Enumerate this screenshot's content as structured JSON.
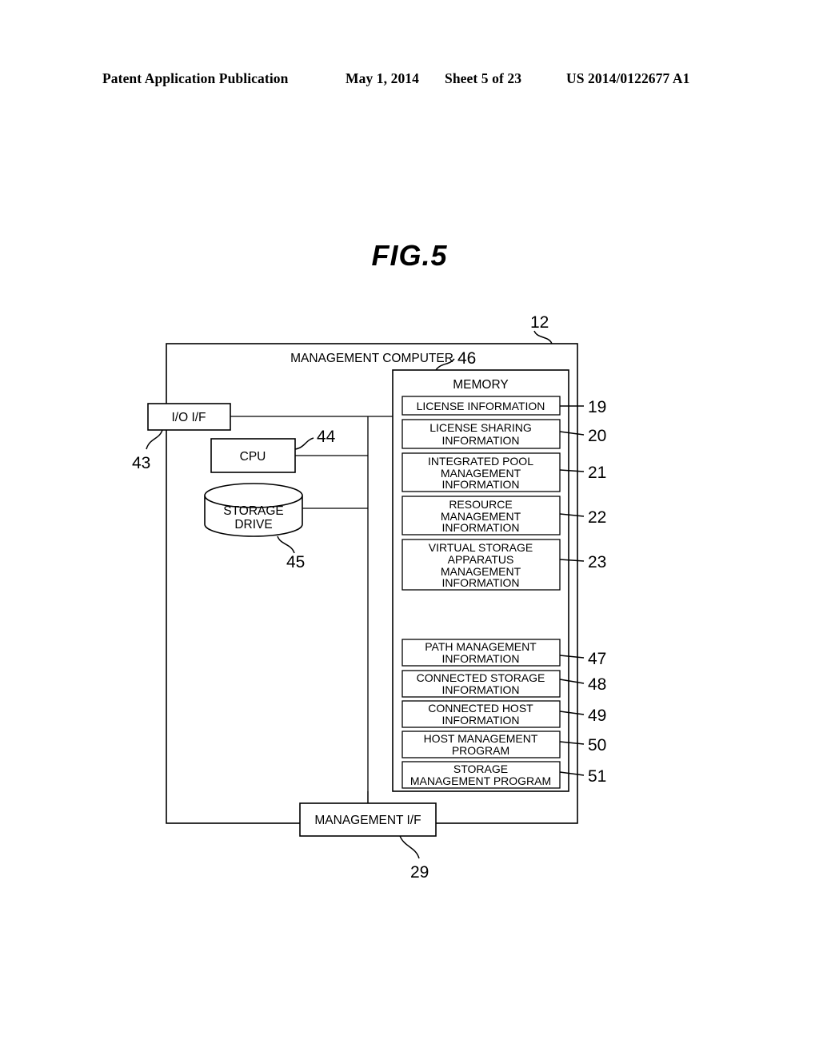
{
  "header": {
    "publication": "Patent Application Publication",
    "date": "May 1, 2014",
    "sheet": "Sheet 5 of 23",
    "number": "US 2014/0122677 A1"
  },
  "figure": {
    "title": "FIG.5"
  },
  "diagram": {
    "outer_box": {
      "label": "MANAGEMENT COMPUTER",
      "ref": "12"
    },
    "memory_box": {
      "label": "MEMORY",
      "ref": "46"
    },
    "io_interface": {
      "label": "I/O I/F",
      "ref": "43"
    },
    "cpu": {
      "label": "CPU",
      "ref": "44"
    },
    "storage_drive": {
      "line1": "STORAGE",
      "line2": "DRIVE",
      "ref": "45"
    },
    "management_interface": {
      "label": "MANAGEMENT I/F",
      "ref": "29"
    },
    "memory_items_upper": [
      {
        "ref": "19",
        "lines": [
          "LICENSE INFORMATION"
        ]
      },
      {
        "ref": "20",
        "lines": [
          "LICENSE SHARING",
          "INFORMATION"
        ]
      },
      {
        "ref": "21",
        "lines": [
          "INTEGRATED POOL",
          "MANAGEMENT",
          "INFORMATION"
        ]
      },
      {
        "ref": "22",
        "lines": [
          "RESOURCE",
          "MANAGEMENT",
          "INFORMATION"
        ]
      },
      {
        "ref": "23",
        "lines": [
          "VIRTUAL STORAGE",
          "APPARATUS",
          "MANAGEMENT",
          "INFORMATION"
        ]
      }
    ],
    "memory_items_lower": [
      {
        "ref": "47",
        "lines": [
          "PATH MANAGEMENT",
          "INFORMATION"
        ]
      },
      {
        "ref": "48",
        "lines": [
          "CONNECTED STORAGE",
          "INFORMATION"
        ]
      },
      {
        "ref": "49",
        "lines": [
          "CONNECTED HOST",
          "INFORMATION"
        ]
      },
      {
        "ref": "50",
        "lines": [
          "HOST MANAGEMENT",
          "PROGRAM"
        ]
      },
      {
        "ref": "51",
        "lines": [
          "STORAGE",
          "MANAGEMENT PROGRAM"
        ]
      }
    ]
  },
  "colors": {
    "ink": "#000000",
    "paper": "#ffffff"
  }
}
